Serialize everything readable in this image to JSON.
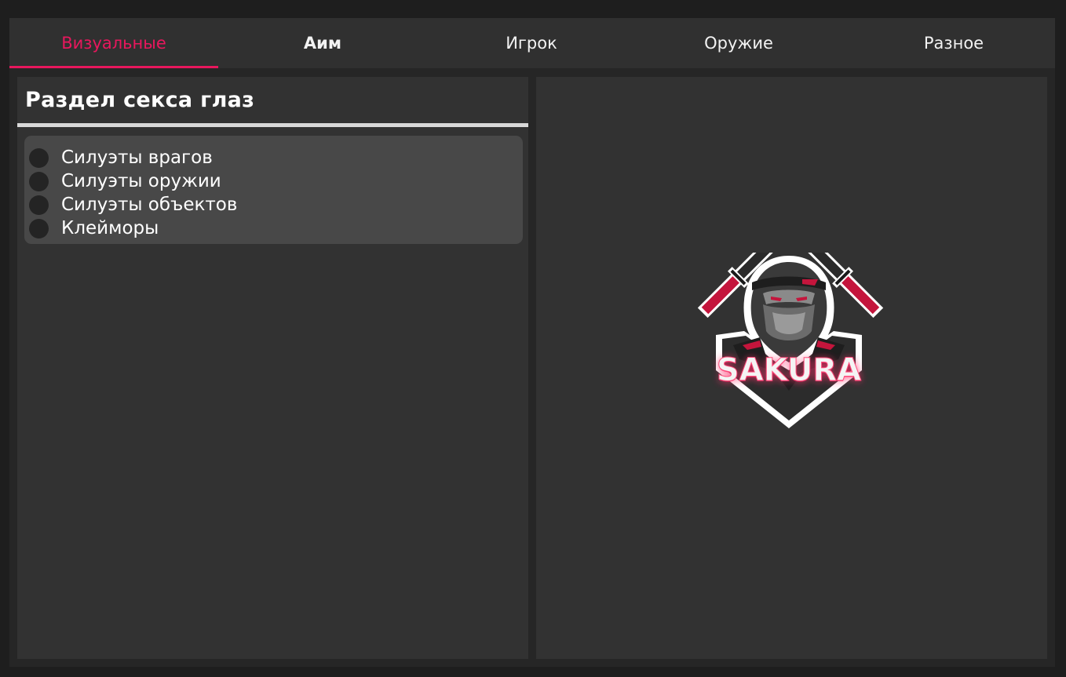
{
  "tabs": [
    {
      "label": "Визуальные",
      "active": true
    },
    {
      "label": "Аим",
      "active": false
    },
    {
      "label": "Игрок",
      "active": false
    },
    {
      "label": "Оружие",
      "active": false
    },
    {
      "label": "Разное",
      "active": false
    }
  ],
  "section": {
    "title": "Раздел секса глаз",
    "options": [
      {
        "label": "Силуэты врагов",
        "checked": false
      },
      {
        "label": "Силуэты оружии",
        "checked": false
      },
      {
        "label": "Силуэты объектов",
        "checked": false
      },
      {
        "label": "Клейморы",
        "checked": false
      }
    ]
  },
  "logo": {
    "text": "SAKURA",
    "icon": "ninja-crossed-katanas-icon"
  },
  "colors": {
    "accent": "#e8175d",
    "background": "#1e1e1e",
    "panel": "#323232",
    "tabbar": "#303030",
    "options_box": "#484848"
  }
}
